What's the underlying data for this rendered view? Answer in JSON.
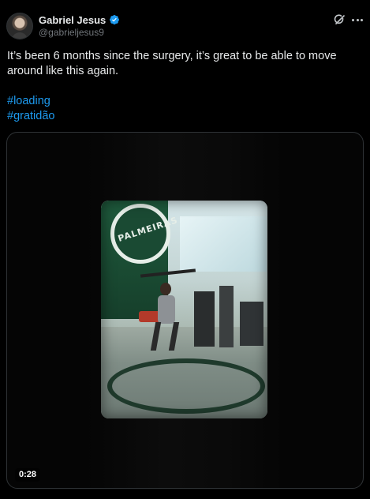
{
  "author": {
    "display_name": "Gabriel Jesus",
    "handle": "@gabrieljesus9",
    "verified": true,
    "avatar": "avatar-photo"
  },
  "header_actions": {
    "grok_icon": "grok-icon",
    "more_icon": "more-dots-icon"
  },
  "post": {
    "text": "It’s been 6 months since the surgery, it’s great to be able to move around like this again.",
    "hashtags": [
      "#loading",
      "#gratidão"
    ]
  },
  "media": {
    "type": "video",
    "duration": "0:28",
    "scene_text": "PALMEIRAS"
  },
  "colors": {
    "background": "#000000",
    "text": "#e7e9ea",
    "secondary_text": "#71767b",
    "link": "#1d9bf0",
    "verified_badge": "#1d9bf0",
    "border": "#2f3336"
  }
}
